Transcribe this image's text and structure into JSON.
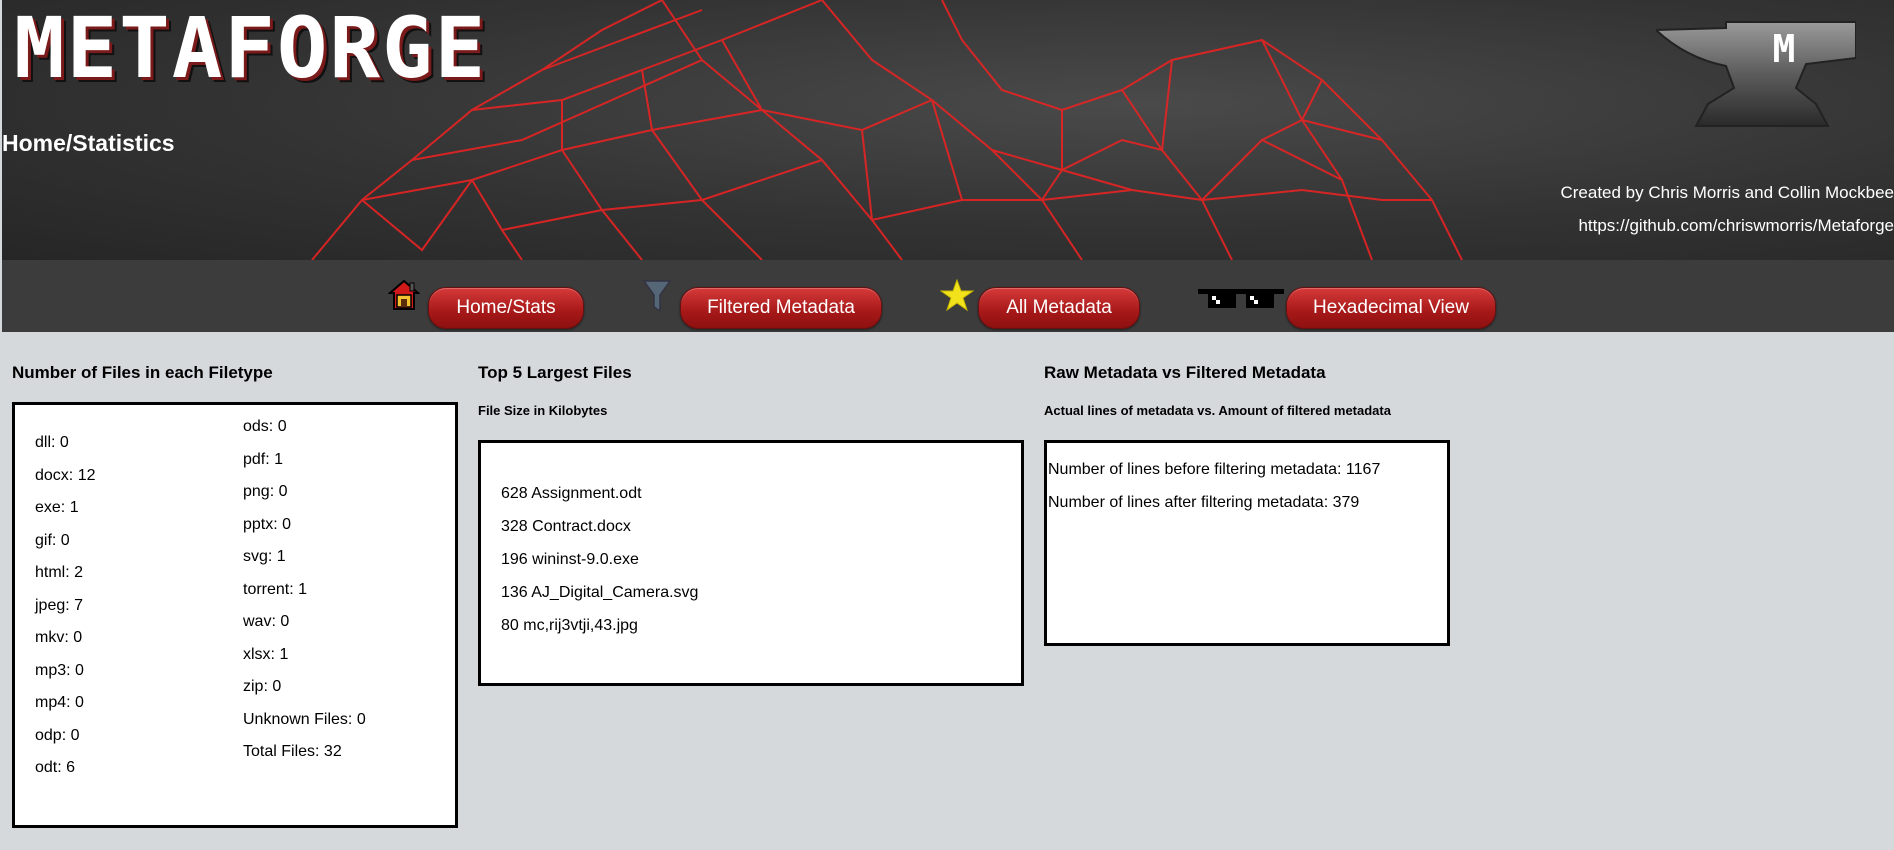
{
  "header": {
    "logo_text": "METAFORGE",
    "page_title": "Home/Statistics",
    "credits": "Created by Chris Morris and Collin Mockbee",
    "repo_url": "https://github.com/chriswmorris/Metaforge",
    "anvil_letter": "M"
  },
  "nav": {
    "items": [
      {
        "label": "Home/Stats",
        "icon": "house-icon"
      },
      {
        "label": "Filtered Metadata",
        "icon": "funnel-icon"
      },
      {
        "label": "All Metadata",
        "icon": "star-icon"
      },
      {
        "label": "Hexadecimal View",
        "icon": "sunglasses-icon"
      }
    ]
  },
  "filetypes": {
    "title": "Number of Files in each Filetype",
    "left": [
      "dll: 0",
      "docx: 12",
      "exe: 1",
      "gif: 0",
      "html: 2",
      "jpeg: 7",
      "mkv: 0",
      "mp3: 0",
      "mp4: 0",
      "odp: 0",
      "odt: 6"
    ],
    "right": [
      "ods: 0",
      "pdf: 1",
      "png: 0",
      "pptx: 0",
      "svg: 1",
      "torrent: 1",
      "wav: 0",
      "xlsx: 1",
      "zip: 0",
      "Unknown Files: 0",
      "Total Files: 32"
    ]
  },
  "largest": {
    "title": "Top 5 Largest Files",
    "subtitle": "File Size in Kilobytes",
    "items": [
      "628 Assignment.odt",
      "328 Contract.docx",
      "196 wininst-9.0.exe",
      "136 AJ_Digital_Camera.svg",
      "80 mc,rij3vtji,43.jpg"
    ]
  },
  "raw": {
    "title": "Raw Metadata vs Filtered Metadata",
    "subtitle": "Actual lines of metadata vs. Amount of filtered metadata",
    "items": [
      "Number of lines before filtering metadata: 1167",
      "Number of lines after filtering metadata: 379"
    ]
  },
  "colors": {
    "accent_red": "#c62828",
    "header_bg": "#333333",
    "nav_bg": "#3c3c3c",
    "page_bg": "#d5d9dc"
  }
}
